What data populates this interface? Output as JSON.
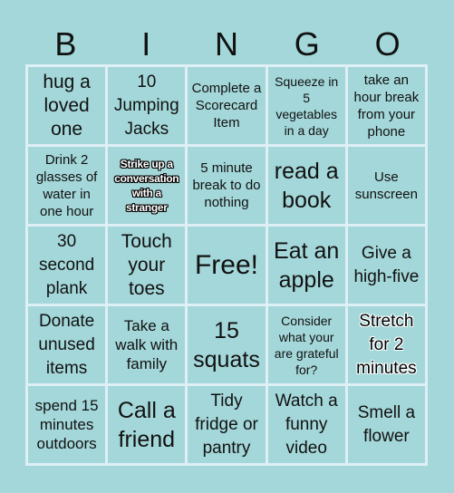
{
  "header": {
    "letters": [
      "B",
      "I",
      "N",
      "G",
      "O"
    ]
  },
  "board": {
    "rows": [
      [
        "hug a loved one",
        "10 Jumping Jacks",
        "Complete a Scorecard Item",
        "Squeeze in 5 vegetables in a day",
        "take an hour break from your phone"
      ],
      [
        "Drink 2 glasses of water in one hour",
        "Strike up a conversation with a stranger",
        "5 minute break to do nothing",
        "read a book",
        "Use sunscreen"
      ],
      [
        "30 second plank",
        "Touch your toes",
        "Free!",
        "Eat an apple",
        "Give a high-five"
      ],
      [
        "Donate unused items",
        "Take a walk with family",
        "15 squats",
        "Consider what your are grateful for?",
        "Stretch for 2 minutes"
      ],
      [
        "spend 15 minutes outdoors",
        "Call a friend",
        "Tidy fridge or pantry",
        "Watch a funny video",
        "Smell a flower"
      ]
    ]
  },
  "colors": {
    "background": "#a4d7d9",
    "grid_lines": "#deeff5",
    "text": "#111111"
  }
}
